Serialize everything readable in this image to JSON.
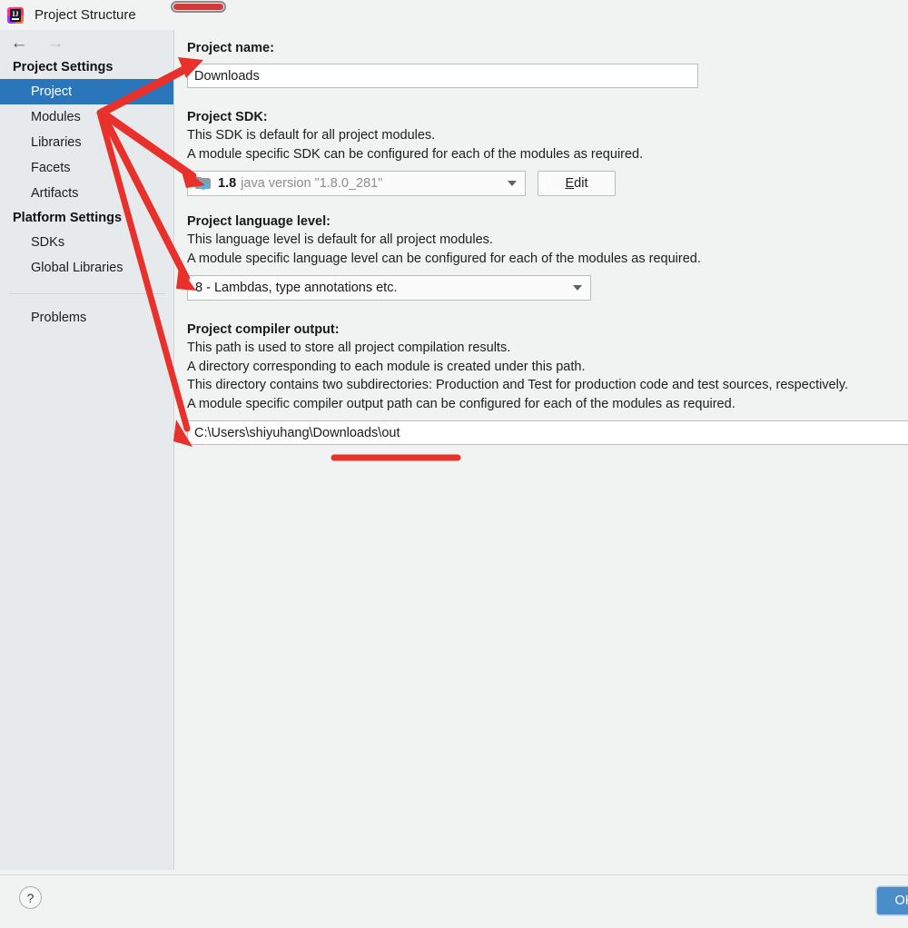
{
  "window": {
    "title": "Project Structure",
    "app_icon": "intellij-idea-icon"
  },
  "nav": {
    "back_icon": "arrow-left-icon",
    "forward_icon": "arrow-right-icon"
  },
  "sidebar": {
    "groups": [
      {
        "title": "Project Settings",
        "items": [
          {
            "label": "Project",
            "selected": true
          },
          {
            "label": "Modules",
            "selected": false
          },
          {
            "label": "Libraries",
            "selected": false
          },
          {
            "label": "Facets",
            "selected": false
          },
          {
            "label": "Artifacts",
            "selected": false
          }
        ]
      },
      {
        "title": "Platform Settings",
        "items": [
          {
            "label": "SDKs",
            "selected": false
          },
          {
            "label": "Global Libraries",
            "selected": false
          }
        ]
      }
    ],
    "problems_label": "Problems"
  },
  "main": {
    "project_name": {
      "label": "Project name:",
      "value": "Downloads",
      "placeholder": ""
    },
    "project_sdk": {
      "label": "Project SDK:",
      "desc_line1": "This SDK is default for all project modules.",
      "desc_line2": "A module specific SDK can be configured for each of the modules as required.",
      "selected_version": "1.8",
      "selected_detail": "java version \"1.8.0_281\"",
      "icon": "folder-java-icon",
      "dropdown_icon": "chevron-down-icon",
      "edit_button": "Edit",
      "edit_button_mnemonic": "E",
      "edit_button_rest": "dit"
    },
    "language_level": {
      "label": "Project language level:",
      "desc_line1": "This language level is default for all project modules.",
      "desc_line2": "A module specific language level can be configured for each of the modules as required.",
      "selected": "8 - Lambdas, type annotations etc.",
      "dropdown_icon": "chevron-down-icon"
    },
    "compiler_output": {
      "label": "Project compiler output:",
      "desc_line1": "This path is used to store all project compilation results.",
      "desc_line2": "A directory corresponding to each module is created under this path.",
      "desc_line3": "This directory contains two subdirectories: Production and Test for production code and test sources, respectively.",
      "desc_line4": "A module specific compiler output path can be configured for each of the modules as required.",
      "value": "C:\\Users\\shiyuhang\\Downloads\\out",
      "placeholder": ""
    }
  },
  "bottom": {
    "help_label": "?",
    "ok_label": "OK"
  },
  "annotations": {
    "color": "#e8312b",
    "top_marker": "red-rounded-highlight",
    "arrows": [
      {
        "name": "arrow-to-project-name"
      },
      {
        "name": "arrow-to-project-sdk"
      },
      {
        "name": "arrow-to-language-level"
      },
      {
        "name": "arrow-to-compiler-output"
      }
    ],
    "underline": "red-underline-under-compiler-output-path"
  },
  "colors": {
    "selection_blue": "#2b75bb",
    "sidebar_bg": "#e6eaed",
    "main_bg": "#f1f2f2",
    "accent_button": "#4b8dc8",
    "annotation_red": "#e8312b"
  }
}
